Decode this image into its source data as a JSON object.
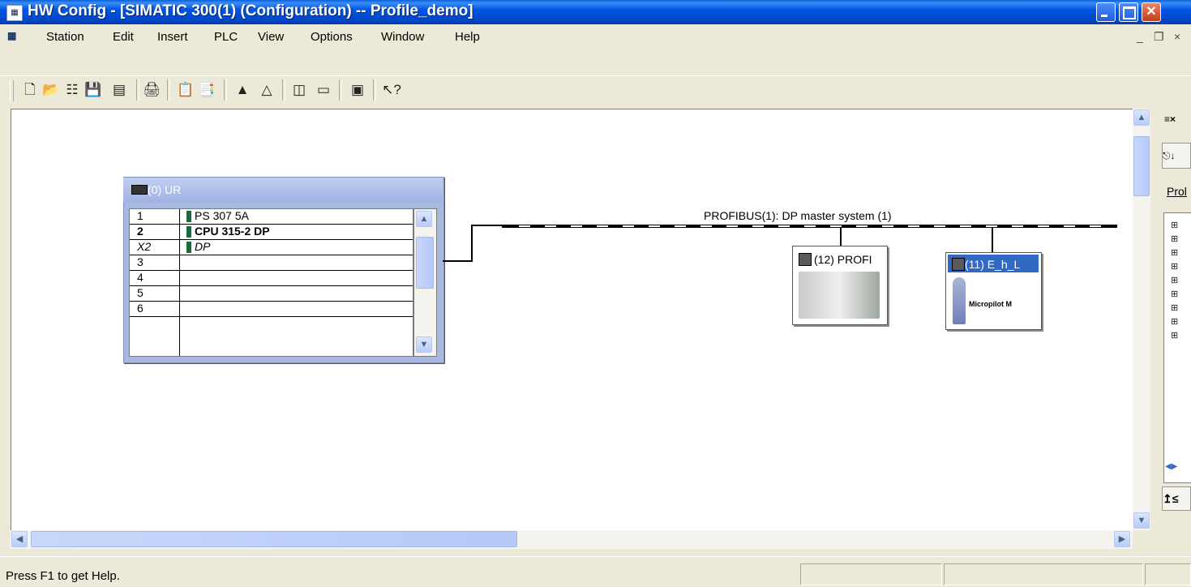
{
  "window": {
    "title": "HW Config - [SIMATIC 300(1) (Configuration) -- Profile_demo]"
  },
  "menu": [
    "Station",
    "Edit",
    "Insert",
    "PLC",
    "View",
    "Options",
    "Window",
    "Help"
  ],
  "mdi_controls": [
    "_",
    "❐",
    "×"
  ],
  "rack": {
    "title": "(0) UR",
    "rows": [
      {
        "slot": "1",
        "module": "PS 307 5A"
      },
      {
        "slot": "2",
        "module": "CPU 315-2 DP"
      },
      {
        "slot": "X2",
        "module": "DP"
      },
      {
        "slot": "3",
        "module": ""
      },
      {
        "slot": "4",
        "module": ""
      },
      {
        "slot": "5",
        "module": ""
      },
      {
        "slot": "6",
        "module": ""
      }
    ]
  },
  "network": {
    "bus_label": "PROFIBUS(1): DP master system (1)",
    "slaves": [
      {
        "title": "(12) PROFI"
      },
      {
        "title": "(11) E_h_L",
        "caption": "Micropilot M"
      }
    ]
  },
  "right_panel": {
    "label": "Prol"
  },
  "status": {
    "text": "Press F1 to get Help."
  },
  "colors": {
    "title_bar": "#0054e3",
    "background": "#ece9d8",
    "rack_frame": "#a8b8e0"
  },
  "icons": [
    "new-icon",
    "open-icon",
    "network-icon",
    "save-icon",
    "download-icon",
    "print-icon",
    "copy-icon",
    "paste-icon",
    "upload-icon",
    "station-icon",
    "catalog-icon",
    "module-icon",
    "netpro-icon",
    "help-pointer-icon"
  ]
}
